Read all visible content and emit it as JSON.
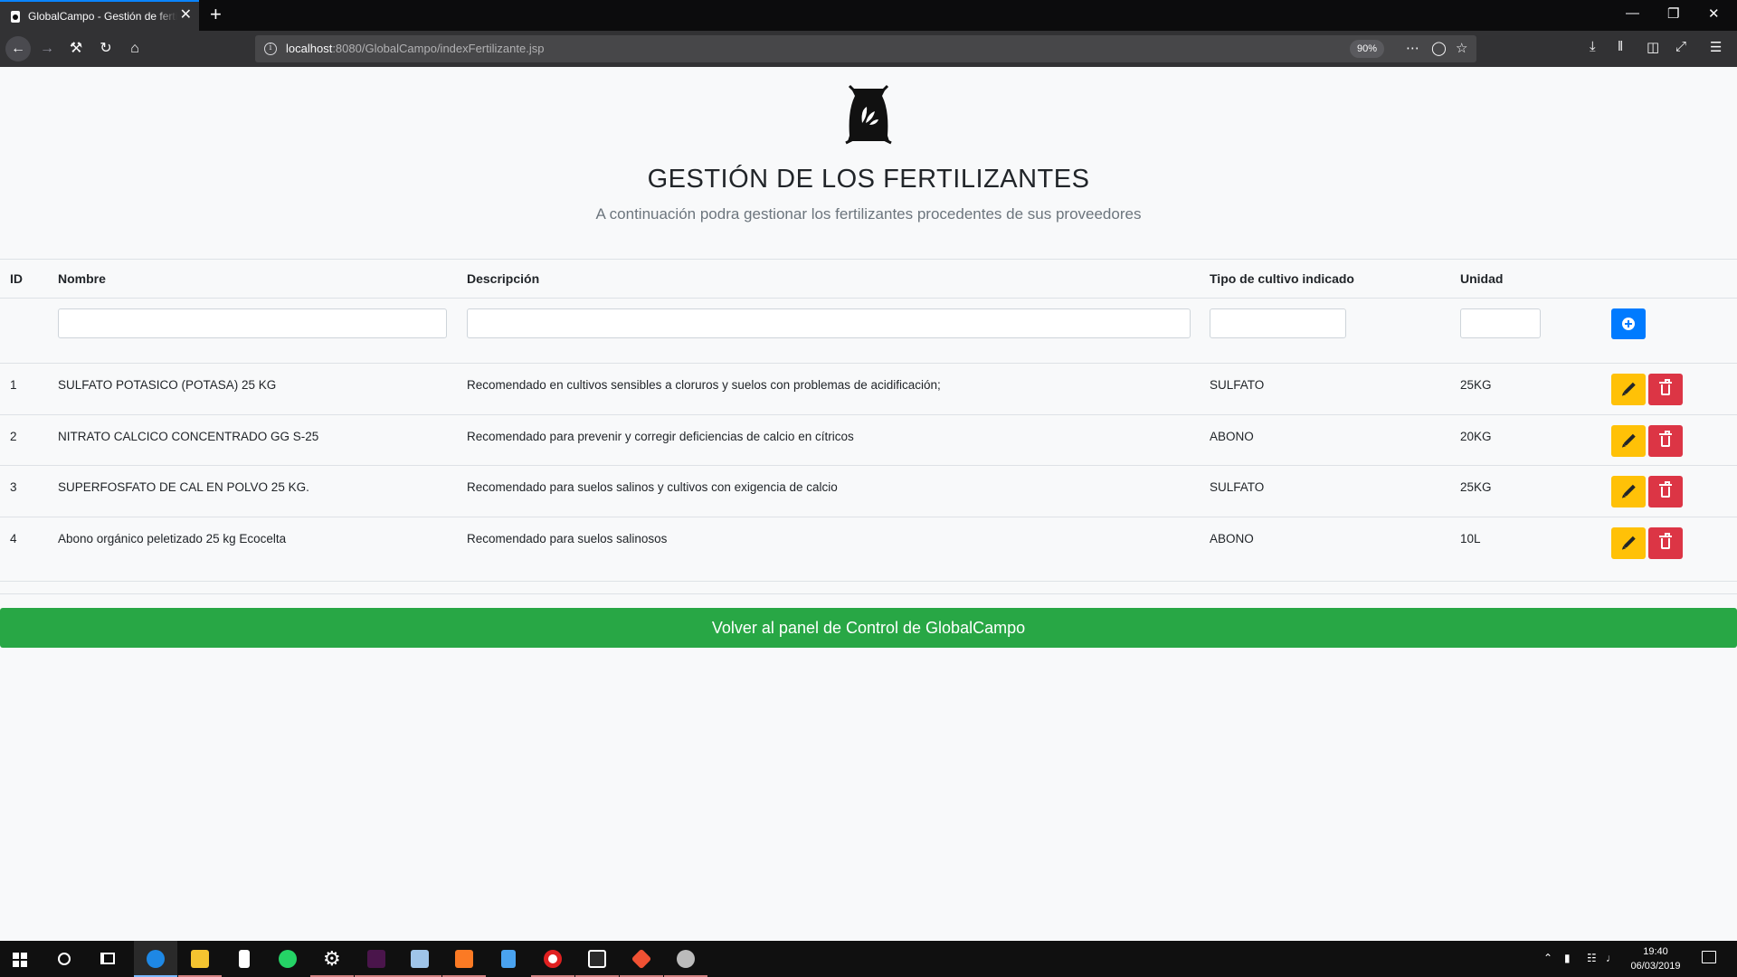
{
  "browser": {
    "tab_title": "GlobalCampo - Gestión de fertilizantes",
    "tab_close": "✕",
    "new_tab": "+",
    "url_host": "localhost",
    "url_rest": ":8080/GlobalCampo/indexFertilizante.jsp",
    "zoom": "90%"
  },
  "page": {
    "title": "GESTIÓN DE LOS FERTILIZANTES",
    "subtitle": "A continuación podra gestionar los fertilizantes procedentes de sus proveedores"
  },
  "table": {
    "headers": [
      "ID",
      "Nombre",
      "Descripción",
      "Tipo de cultivo indicado",
      "Unidad"
    ],
    "new_row": {
      "nombre": "",
      "descripcion": "",
      "tipo": "",
      "unidad": ""
    },
    "rows": [
      {
        "id": "1",
        "nombre": "SULFATO POTASICO (POTASA) 25 KG",
        "descripcion": "Recomendado en cultivos sensibles a cloruros y suelos con problemas de acidificación;",
        "tipo": "SULFATO",
        "unidad": "25KG"
      },
      {
        "id": "2",
        "nombre": "NITRATO CALCICO CONCENTRADO GG S-25",
        "descripcion": "Recomendado para prevenir y corregir deficiencias de calcio en cítricos",
        "tipo": "ABONO",
        "unidad": "20KG"
      },
      {
        "id": "3",
        "nombre": "SUPERFOSFATO DE CAL EN POLVO 25 KG.",
        "descripcion": "Recomendado para suelos salinos y cultivos con exigencia de calcio",
        "tipo": "SULFATO",
        "unidad": "25KG"
      },
      {
        "id": "4",
        "nombre": "Abono orgánico peletizado 25 kg Ecocelta",
        "descripcion": "Recomendado para suelos salinosos",
        "tipo": "ABONO",
        "unidad": "10L"
      }
    ]
  },
  "back_button": "Volver al panel de Control de GlobalCampo",
  "taskbar": {
    "time": "19:40",
    "date": "06/03/2019"
  },
  "colors": {
    "add": "#007bff",
    "edit": "#ffc107",
    "delete": "#dc3545",
    "back": "#28a745"
  }
}
